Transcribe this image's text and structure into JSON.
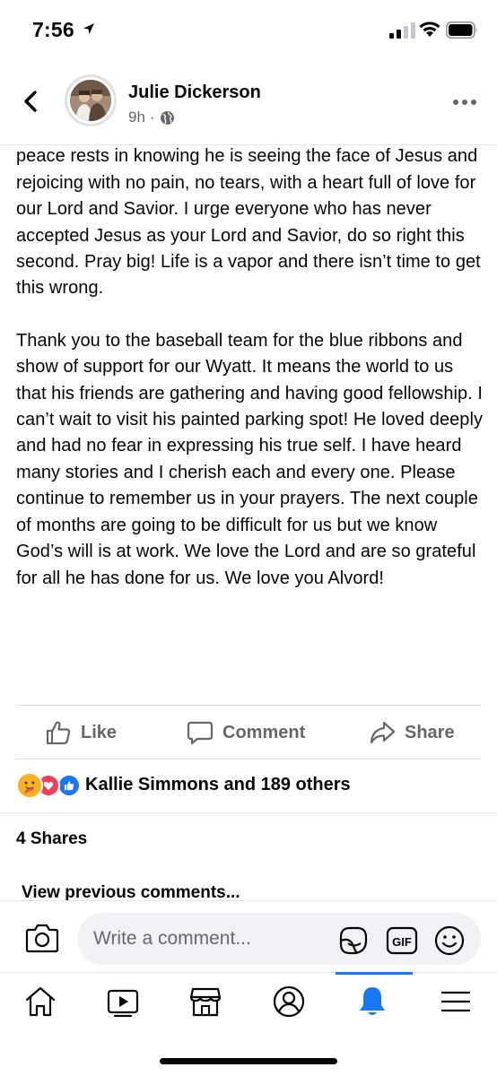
{
  "status_bar": {
    "time": "7:56"
  },
  "header": {
    "author_name": "Julie Dickerson",
    "post_age": "9h",
    "separator": "·"
  },
  "post": {
    "paragraphs": [
      "keeping us going. Please pray big prayers for us. My peace rests in knowing he is seeing the face of Jesus and rejoicing with no pain, no tears, with a heart full of love for our Lord and Savior. I urge everyone who has never accepted Jesus as your Lord and Savior, do so right this second. Pray big! Life is a vapor and there isn’t time to get this wrong.",
      "Thank you to the baseball team for the blue ribbons and show of support for our Wyatt. It means the world to us that his friends are gathering and having good fellowship. I can’t wait to visit his painted parking spot! He loved deeply and had no fear in expressing his true self. I have heard many stories and I cherish each and every one. Please continue to remember us in your prayers.  The next couple of months are going to be difficult for us but we know God’s will is at work. We love the Lord and are so grateful for all he has done for us. We love you Alvord!"
    ]
  },
  "actions": {
    "like_label": "Like",
    "comment_label": "Comment",
    "share_label": "Share"
  },
  "reactions": {
    "summary": "Kallie Simmons and 189 others",
    "types": [
      "care",
      "love",
      "like"
    ]
  },
  "shares": {
    "label": "4 Shares"
  },
  "comments": {
    "view_previous": "View previous comments..."
  },
  "composer": {
    "placeholder": "Write a comment..."
  },
  "tab_bar": {
    "items": [
      "home-icon",
      "watch-icon",
      "marketplace-icon",
      "profile-icon",
      "notifications-icon",
      "menu-icon"
    ],
    "active": "notifications-icon"
  },
  "colors": {
    "brand_blue": "#1877f2",
    "secondary_text": "#65676b",
    "primary_text": "#050505"
  }
}
